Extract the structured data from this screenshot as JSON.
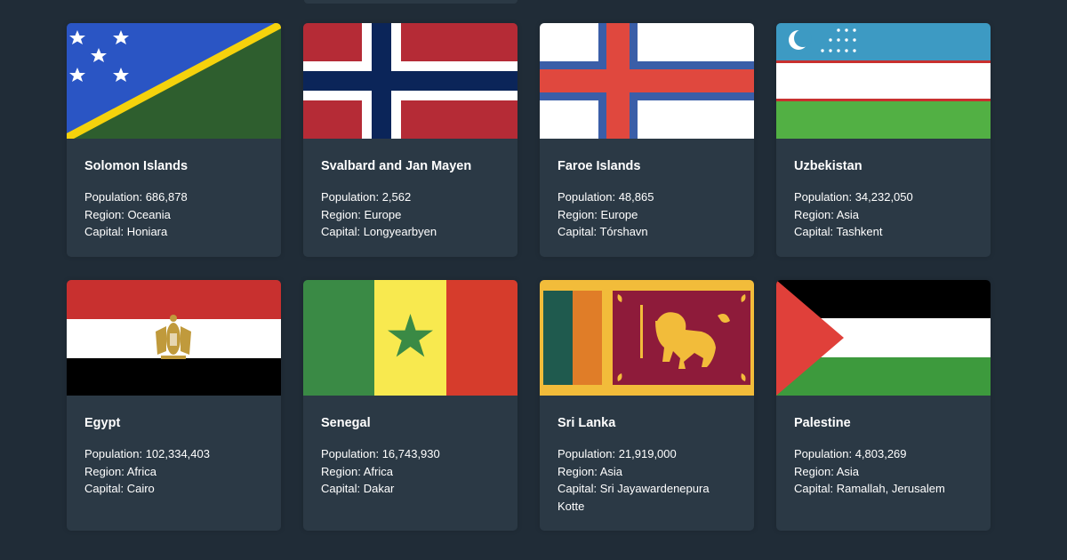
{
  "countries": [
    {
      "name": "Solomon Islands",
      "population_label": "Population:",
      "population": "686,878",
      "region_label": "Region:",
      "region": "Oceania",
      "capital_label": "Capital:",
      "capital": "Honiara",
      "flag": "solomon-islands-flag"
    },
    {
      "name": "Svalbard and Jan Mayen",
      "population_label": "Population:",
      "population": "2,562",
      "region_label": "Region:",
      "region": "Europe",
      "capital_label": "Capital:",
      "capital": "Longyearbyen",
      "flag": "svalbard-flag"
    },
    {
      "name": "Faroe Islands",
      "population_label": "Population:",
      "population": "48,865",
      "region_label": "Region:",
      "region": "Europe",
      "capital_label": "Capital:",
      "capital": "Tórshavn",
      "flag": "faroe-islands-flag"
    },
    {
      "name": "Uzbekistan",
      "population_label": "Population:",
      "population": "34,232,050",
      "region_label": "Region:",
      "region": "Asia",
      "capital_label": "Capital:",
      "capital": "Tashkent",
      "flag": "uzbekistan-flag"
    },
    {
      "name": "Egypt",
      "population_label": "Population:",
      "population": "102,334,403",
      "region_label": "Region:",
      "region": "Africa",
      "capital_label": "Capital:",
      "capital": "Cairo",
      "flag": "egypt-flag"
    },
    {
      "name": "Senegal",
      "population_label": "Population:",
      "population": "16,743,930",
      "region_label": "Region:",
      "region": "Africa",
      "capital_label": "Capital:",
      "capital": "Dakar",
      "flag": "senegal-flag"
    },
    {
      "name": "Sri Lanka",
      "population_label": "Population:",
      "population": "21,919,000",
      "region_label": "Region:",
      "region": "Asia",
      "capital_label": "Capital:",
      "capital": "Sri Jayawardenepura Kotte",
      "flag": "sri-lanka-flag"
    },
    {
      "name": "Palestine",
      "population_label": "Population:",
      "population": "4,803,269",
      "region_label": "Region:",
      "region": "Asia",
      "capital_label": "Capital:",
      "capital": "Ramallah, Jerusalem",
      "flag": "palestine-flag"
    }
  ],
  "colors": {
    "background": "#202c37",
    "card": "#2b3945",
    "text": "#ffffff"
  }
}
